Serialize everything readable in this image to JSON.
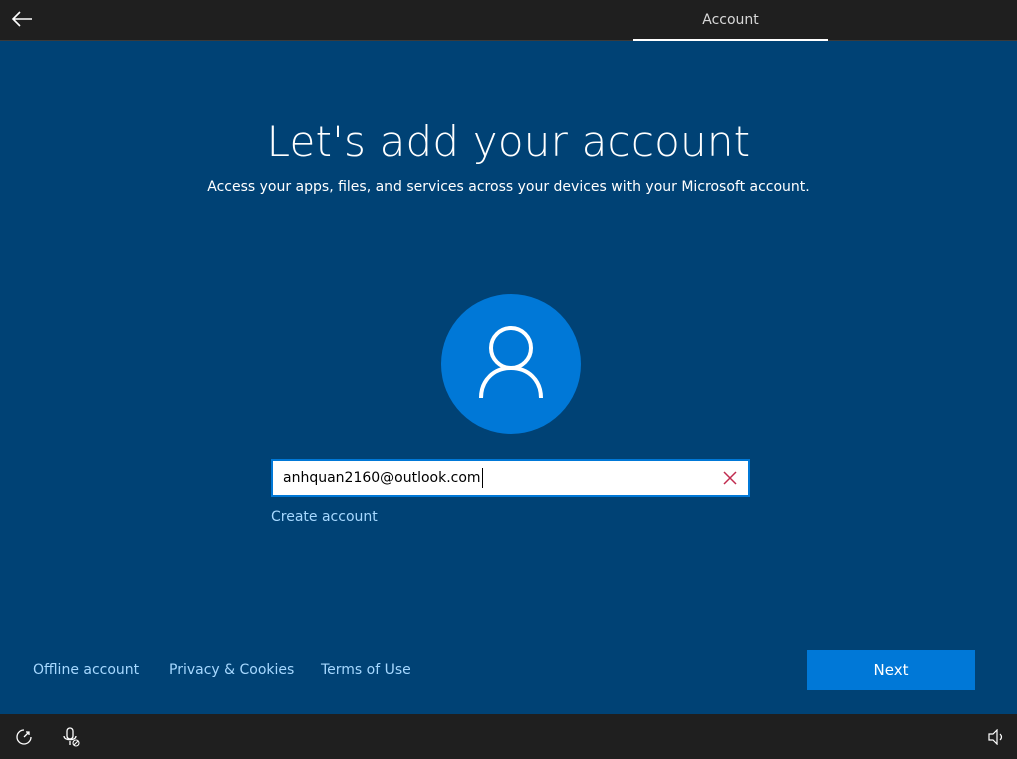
{
  "header": {
    "step_label": "Account"
  },
  "main": {
    "title": "Let's add your account",
    "subtitle": "Access your apps, files, and services across your devices with your Microsoft account.",
    "email_value": "anhquan2160@outlook.com",
    "create_account_label": "Create account"
  },
  "footer": {
    "offline_label": "Offline account",
    "privacy_label": "Privacy & Cookies",
    "terms_label": "Terms of Use",
    "next_label": "Next"
  },
  "icons": {
    "back": "back-arrow-icon",
    "avatar": "person-icon",
    "clear": "close-icon",
    "ease_of_access": "ease-of-access-icon",
    "microphone": "microphone-muted-icon",
    "volume": "volume-icon"
  },
  "colors": {
    "background": "#004275",
    "accent": "#0078d7",
    "link": "#a6d8ff",
    "bar": "#1f1f1f",
    "clear_icon": "#c02b4e"
  }
}
